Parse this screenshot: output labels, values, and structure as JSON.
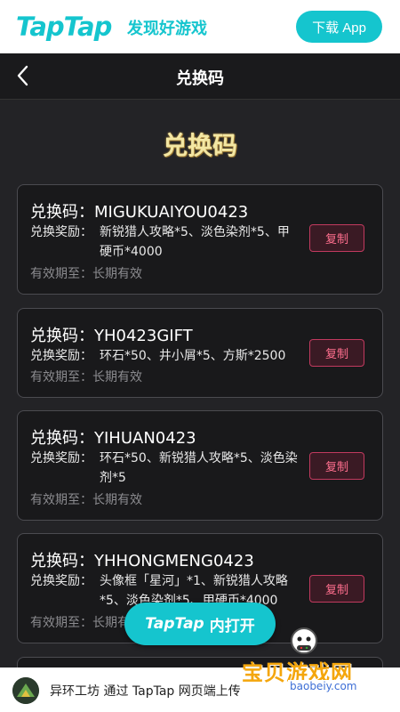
{
  "topbar": {
    "brand": "TapTap",
    "slogan": "发现好游戏",
    "download_label": "下载 App"
  },
  "nav": {
    "title": "兑换码"
  },
  "heading": "兑换码",
  "labels": {
    "code_prefix": "兑换码：",
    "reward_prefix": "兑换奖励：",
    "valid_prefix": "有效期至：",
    "copy": "复制"
  },
  "cards": [
    {
      "code": "MIGUKUAIYOU0423",
      "reward": "新锐猎人攻略*5、淡色染剂*5、甲硬币*4000",
      "valid": "长期有效"
    },
    {
      "code": "YH0423GIFT",
      "reward": "环石*50、井小屑*5、方斯*2500",
      "valid": "长期有效"
    },
    {
      "code": "YIHUAN0423",
      "reward": "环石*50、新锐猎人攻略*5、淡色染剂*5",
      "valid": "长期有效"
    },
    {
      "code": "YHHONGMENG0423",
      "reward": "头像框「星河」*1、新锐猎人攻略*5、淡色染剂*5、甲硬币*4000",
      "valid": "长期有效"
    }
  ],
  "open_in_app": {
    "brand": "TapTap",
    "label": "内打开"
  },
  "footer": {
    "text": "异环工坊 通过 TapTap 网页端上传"
  },
  "watermark": {
    "text": "宝贝游戏网",
    "url": "baobeiy.com"
  },
  "colors": {
    "accent": "#15c5ce",
    "copy_border": "#c23a5f",
    "heading": "#f3e7a3"
  }
}
